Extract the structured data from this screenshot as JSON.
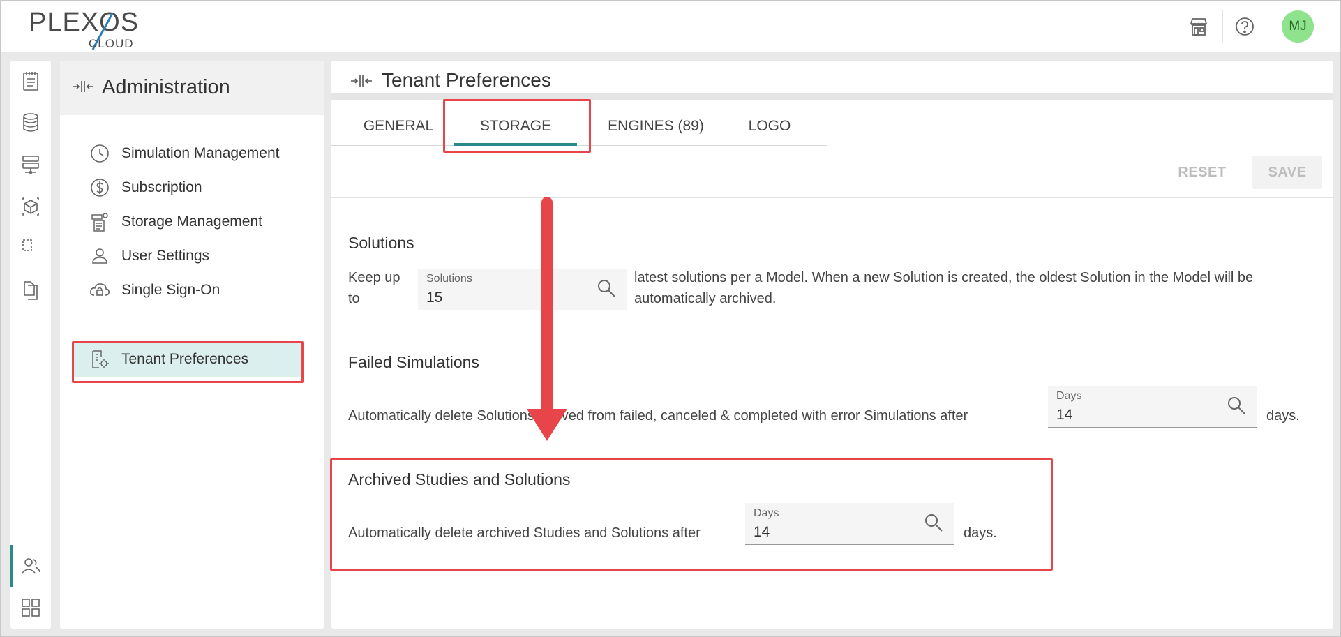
{
  "header": {
    "logo_text": "PLEXOS",
    "logo_sub": "CLOUD",
    "avatar_initials": "MJ",
    "icons": [
      "store-icon",
      "help-icon"
    ]
  },
  "rail": {
    "icons": [
      "notepad-icon",
      "database-icon",
      "server-icon",
      "cube-icon",
      "document-compare-icon",
      "document-copy-icon",
      "users-icon",
      "grid-icon"
    ]
  },
  "admin": {
    "title": "Administration",
    "items": [
      {
        "label": "Simulation Management",
        "icon": "clock-icon"
      },
      {
        "label": "Subscription",
        "icon": "dollar-icon"
      },
      {
        "label": "Storage Management",
        "icon": "storage-icon"
      },
      {
        "label": "User Settings",
        "icon": "user-icon"
      },
      {
        "label": "Single Sign-On",
        "icon": "cloud-lock-icon"
      },
      {
        "label": "Tenant Preferences",
        "icon": "tenant-settings-icon",
        "active": true
      }
    ]
  },
  "content": {
    "title": "Tenant Preferences",
    "tabs": [
      {
        "label": "GENERAL"
      },
      {
        "label": "STORAGE",
        "active": true
      },
      {
        "label": "ENGINES (89)"
      },
      {
        "label": "LOGO"
      }
    ],
    "toolbar": {
      "reset_label": "RESET",
      "save_label": "SAVE"
    },
    "solutions": {
      "title": "Solutions",
      "prefix": "Keep up to",
      "field_label": "Solutions",
      "field_value": "15",
      "suffix": "latest solutions per a Model. When a new Solution is created, the oldest Solution in the Model will be automatically archived."
    },
    "failed": {
      "title": "Failed Simulations",
      "prefix": "Automatically delete Solutions derived from failed, canceled & completed with error Simulations after",
      "field_label": "Days",
      "field_value": "14",
      "suffix": "days."
    },
    "archived": {
      "title": "Archived Studies and Solutions",
      "prefix": "Automatically delete archived Studies and Solutions after",
      "field_label": "Days",
      "field_value": "14",
      "suffix": "days."
    }
  },
  "colors": {
    "accent": "#2a8a8a",
    "annotation": "#e8454a",
    "avatar_bg": "#8fe38c"
  }
}
